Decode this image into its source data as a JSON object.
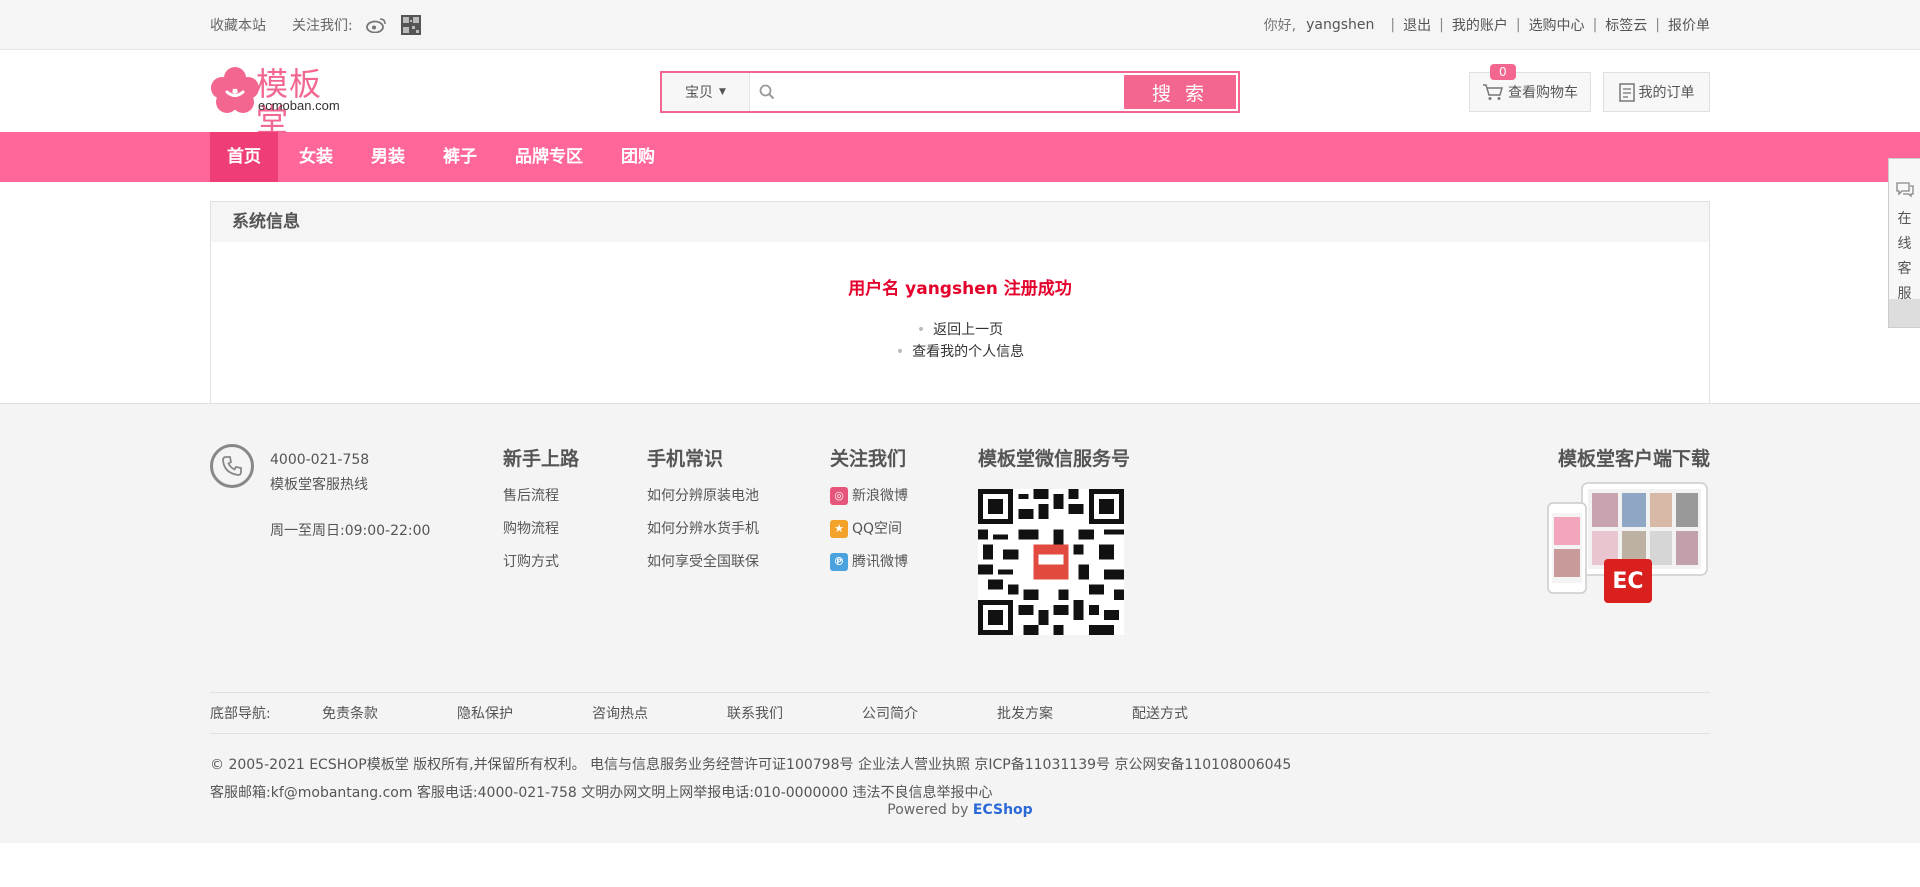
{
  "topbar": {
    "bookmark": "收藏本站",
    "follow_label": "关注我们:",
    "greeting": "你好,",
    "username": "yangshen",
    "links": [
      "退出",
      "我的账户",
      "选购中心",
      "标签云",
      "报价单"
    ]
  },
  "logo": {
    "cn": "模板堂",
    "en": "ecmoban.com"
  },
  "search": {
    "category": "宝贝",
    "placeholder": "",
    "button": "搜 索"
  },
  "cart": {
    "count": "0",
    "label": "查看购物车"
  },
  "orders": {
    "label": "我的订单"
  },
  "nav": [
    "首页",
    "女装",
    "男装",
    "裤子",
    "品牌专区",
    "团购"
  ],
  "message": {
    "title": "系统信息",
    "success": "用户名 yangshen 注册成功",
    "links": [
      "返回上一页",
      "查看我的个人信息"
    ]
  },
  "footer": {
    "phone": "4000-021-758",
    "hotline_label": "模板堂客服热线",
    "hours": "周一至周日:09:00-22:00",
    "columns": [
      {
        "title": "新手上路",
        "items": [
          "售后流程",
          "购物流程",
          "订购方式"
        ]
      },
      {
        "title": "手机常识",
        "items": [
          "如何分辨原装电池",
          "如何分辨水货手机",
          "如何享受全国联保"
        ]
      }
    ],
    "follow": {
      "title": "关注我们",
      "items": [
        "新浪微博",
        "QQ空间",
        "腾讯微博"
      ]
    },
    "wechat_title": "模板堂微信服务号",
    "app_title": "模板堂客户端下载",
    "bottom_nav_label": "底部导航:",
    "bottom_nav": [
      "免责条款",
      "隐私保护",
      "咨询热点",
      "联系我们",
      "公司简介",
      "批发方案",
      "配送方式"
    ],
    "copyright_line1": "© 2005-2021 ECSHOP模板堂 版权所有,并保留所有权利。  电信与信息服务业务经营许可证100798号  企业法人营业执照  京ICP备11031139号  京公网安备110108006045",
    "copyright_line2": "客服邮箱:kf@mobantang.com  客服电话:4000-021-758  文明办网文明上网举报电话:010-0000000  违法不良信息举报中心",
    "powered_by": "Powered by",
    "powered_brand": "ECShop"
  },
  "sidetab": [
    "在",
    "线",
    "客",
    "服"
  ],
  "colors": {
    "brand_pink": "#ff6699",
    "nav_active": "#ef3e75",
    "success_red": "#e4002b"
  }
}
